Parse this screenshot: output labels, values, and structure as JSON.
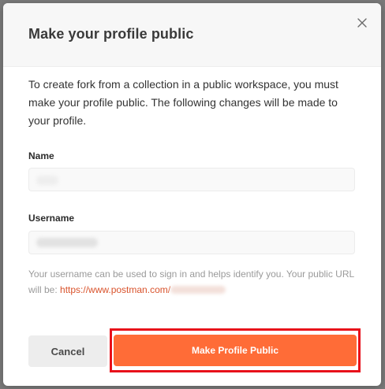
{
  "dialog": {
    "title": "Make your profile public",
    "close_icon": "close-icon",
    "description": "To create fork from a collection in a public workspace, you must make your profile public. The following changes will be made to your profile."
  },
  "fields": {
    "name": {
      "label": "Name",
      "value": ""
    },
    "username": {
      "label": "Username",
      "value": ""
    }
  },
  "help": {
    "text": "Your username can be used to sign in and helps identify you. Your public URL will be: ",
    "link_text": "https://www.postman.com/"
  },
  "actions": {
    "cancel_label": "Cancel",
    "primary_label": "Make Profile Public"
  },
  "colors": {
    "accent": "#ff6c37",
    "link": "#d9532c",
    "highlight": "#e8101a"
  }
}
